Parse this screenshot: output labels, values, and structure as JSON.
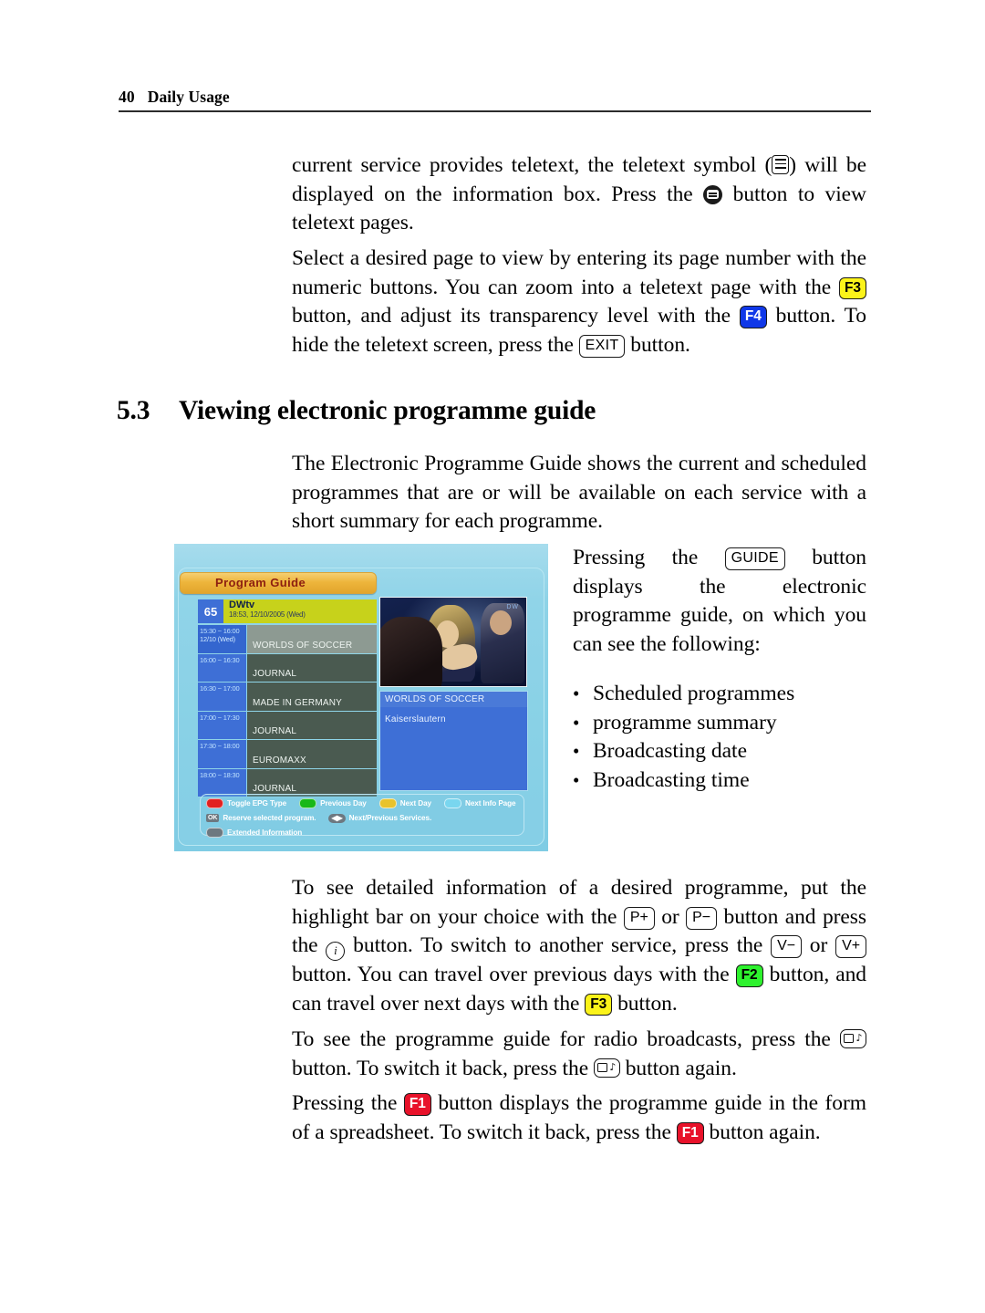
{
  "header": {
    "page_number": "40",
    "title": "Daily Usage"
  },
  "paragraphs": {
    "teletext_1a": "current service provides teletext, the teletext symbol (",
    "teletext_1b": ") will be displayed on the information box.  Press the ",
    "teletext_1c": " button to view teletext pages.",
    "teletext_2a": "Select a desired page to view by entering its page number with the numeric buttons. You can zoom into a teletext page with the ",
    "teletext_2b": " button, and adjust its transparency level with the ",
    "teletext_2c": " button. To hide the teletext screen, press the ",
    "teletext_2d": " button.",
    "epg_intro": "The Electronic Programme Guide shows the current and scheduled programmes that are or will be available on each service with a short summary for each programme.",
    "guide_a": "Pressing the ",
    "guide_b": " button displays the electronic programme guide, on which you can see the following:",
    "detail_a": "To see detailed information of a desired programme, put the highlight bar on your choice with the ",
    "detail_b": " or ",
    "detail_c": " button and press the ",
    "detail_d": " button. To switch to another service, press the ",
    "detail_e": " or ",
    "detail_f": " button. You can travel over previous days with the ",
    "detail_g": " button, and can travel over next days with the ",
    "detail_h": " button.",
    "radio_a": "To see the programme guide for radio broadcasts, press the ",
    "radio_b": " button. To switch it back, press the ",
    "radio_c": " button again.",
    "spreadsheet_a": "Pressing the ",
    "spreadsheet_b": " button displays the programme guide in the form of a spreadsheet. To switch it back, press the ",
    "spreadsheet_c": " button again."
  },
  "section": {
    "number": "5.3",
    "title": "Viewing electronic programme guide"
  },
  "keys": {
    "f1": "F1",
    "f2": "F2",
    "f3": "F3",
    "f4": "F4",
    "exit": "EXIT",
    "guide": "GUIDE",
    "p_plus": "P+",
    "p_minus": "P−",
    "v_plus": "V+",
    "v_minus": "V−"
  },
  "key_colors": {
    "f1_bg": "#e8122a",
    "f1_fg": "#ffffff",
    "f2_bg": "#2ef22e",
    "f2_fg": "#000000",
    "f3_bg": "#fbf31a",
    "f3_fg": "#000000",
    "f4_bg": "#1038e8",
    "f4_fg": "#ffffff"
  },
  "bullets": [
    "Scheduled programmes",
    "programme summary",
    "Broadcasting date",
    "Broadcasting time"
  ],
  "epg": {
    "window_title": "Program Guide",
    "channel": {
      "number": "65",
      "name": "DWtv",
      "clock": "18:53, 12/10/2005 (Wed)"
    },
    "schedule": [
      {
        "time": "15:30 ~ 16:00",
        "date": "12/10 (Wed)",
        "programme": "WORLDS OF SOCCER",
        "selected": true
      },
      {
        "time": "16:00 ~ 16:30",
        "date": "",
        "programme": "JOURNAL",
        "selected": false
      },
      {
        "time": "16:30 ~ 17:00",
        "date": "",
        "programme": "MADE IN GERMANY",
        "selected": false
      },
      {
        "time": "17:00 ~ 17:30",
        "date": "",
        "programme": "JOURNAL",
        "selected": false
      },
      {
        "time": "17:30 ~ 18:00",
        "date": "",
        "programme": "EUROMAXX",
        "selected": false
      },
      {
        "time": "18:00 ~ 18:30",
        "date": "",
        "programme": "JOURNAL",
        "selected": false
      }
    ],
    "info": {
      "title": "WORLDS OF SOCCER",
      "summary": "Kaiserslautern"
    },
    "still_logo": "DW",
    "legend": {
      "red": "Toggle EPG Type",
      "green": "Previous Day",
      "yellow": "Next Day",
      "cyan": "Next Info Page",
      "ok_key": "OK",
      "ok_label": "Reserve selected program.",
      "arrows_label": "Next/Previous Services.",
      "i_key": "i",
      "i_label": "Extended Information"
    }
  }
}
